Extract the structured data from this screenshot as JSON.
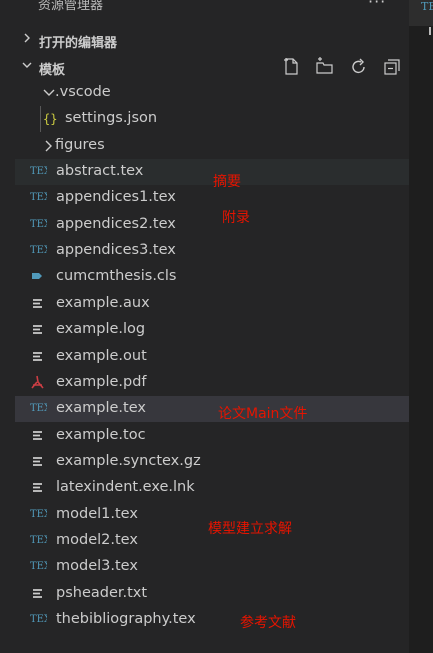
{
  "explorer": {
    "title": "资源管理器",
    "more_label": "···",
    "open_editors_label": "打开的编辑器",
    "folder_label": "模板",
    "toolbar": [
      "new-file",
      "new-folder",
      "refresh",
      "collapse-all"
    ]
  },
  "tree": [
    {
      "label": ".vscode",
      "kind": "folder-open",
      "level": 1
    },
    {
      "label": "settings.json",
      "kind": "json",
      "level": 2
    },
    {
      "label": "figures",
      "kind": "folder-closed",
      "level": 1
    },
    {
      "label": "abstract.tex",
      "kind": "tex",
      "level": 0,
      "state": "hover"
    },
    {
      "label": "appendices1.tex",
      "kind": "tex",
      "level": 0
    },
    {
      "label": "appendices2.tex",
      "kind": "tex",
      "level": 0
    },
    {
      "label": "appendices3.tex",
      "kind": "tex",
      "level": 0
    },
    {
      "label": "cumcmthesis.cls",
      "kind": "cls",
      "level": 0
    },
    {
      "label": "example.aux",
      "kind": "text",
      "level": 0
    },
    {
      "label": "example.log",
      "kind": "text",
      "level": 0
    },
    {
      "label": "example.out",
      "kind": "text",
      "level": 0
    },
    {
      "label": "example.pdf",
      "kind": "pdf",
      "level": 0
    },
    {
      "label": "example.tex",
      "kind": "tex",
      "level": 0,
      "state": "selected"
    },
    {
      "label": "example.toc",
      "kind": "text",
      "level": 0
    },
    {
      "label": "example.synctex.gz",
      "kind": "text",
      "level": 0
    },
    {
      "label": "latexindent.exe.lnk",
      "kind": "text",
      "level": 0
    },
    {
      "label": "model1.tex",
      "kind": "tex",
      "level": 0
    },
    {
      "label": "model2.tex",
      "kind": "tex",
      "level": 0
    },
    {
      "label": "model3.tex",
      "kind": "tex",
      "level": 0
    },
    {
      "label": "psheader.txt",
      "kind": "text",
      "level": 0
    },
    {
      "label": "thebibliography.tex",
      "kind": "tex",
      "level": 0
    }
  ],
  "annotations": {
    "abstract": "摘要",
    "appendix": "附录",
    "main": "论文Main文件",
    "model": "模型建立求解",
    "references": "参考文献"
  },
  "tex_icon_text": "TEX",
  "editor_tab_fragment": "TE",
  "colors": {
    "sidebar_bg": "#252526",
    "selected_bg": "#37373d",
    "hover_bg": "#2a2d2e",
    "tex_icon": "#519aba",
    "pdf_icon": "#cc3e44",
    "json_icon": "#cbcb41",
    "annotation": "#e51400"
  }
}
